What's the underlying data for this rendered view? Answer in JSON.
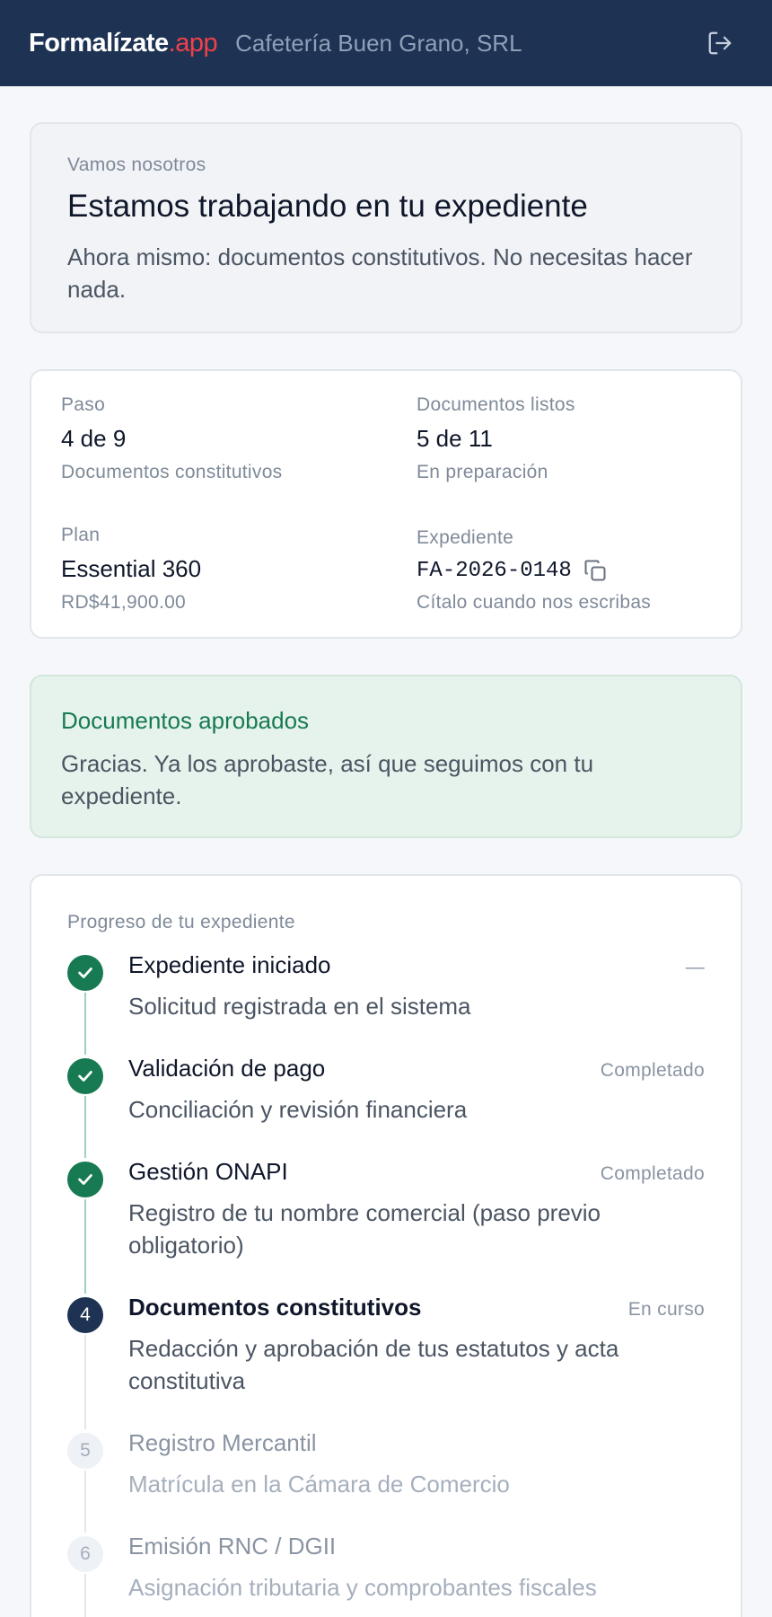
{
  "header": {
    "brand_main": "Formalízate",
    "brand_suffix": ".app",
    "company": "Cafetería Buen Grano, SRL",
    "logout_icon": "logout-icon"
  },
  "hero": {
    "eyebrow": "Vamos nosotros",
    "title": "Estamos trabajando en tu expediente",
    "description": "Ahora mismo: documentos constitutivos. No necesitas hacer nada."
  },
  "summary": {
    "step": {
      "label": "Paso",
      "value": "4 de 9",
      "sub": "Documentos constitutivos"
    },
    "docs": {
      "label": "Documentos listos",
      "value": "5 de 11",
      "sub": "En preparación"
    },
    "plan": {
      "label": "Plan",
      "value": "Essential 360",
      "sub": "RD$41,900.00"
    },
    "file": {
      "label": "Expediente",
      "value": "FA-2026-0148",
      "sub": "Cítalo cuando nos escribas",
      "copy_icon": "copy-icon"
    }
  },
  "approved": {
    "title": "Documentos aprobados",
    "text": "Gracias. Ya los aprobaste, así que seguimos con tu expediente."
  },
  "progress": {
    "title": "Progreso de tu expediente",
    "steps": [
      {
        "name": "Expediente iniciado",
        "status": "—",
        "desc": "Solicitud registrada en el sistema",
        "state": "done"
      },
      {
        "name": "Validación de pago",
        "status": "Completado",
        "desc": "Conciliación y revisión financiera",
        "state": "done"
      },
      {
        "name": "Gestión ONAPI",
        "status": "Completado",
        "desc": "Registro de tu nombre comercial (paso previo obligatorio)",
        "state": "done"
      },
      {
        "number": "4",
        "name": "Documentos constitutivos",
        "status": "En curso",
        "desc": "Redacción y aprobación de tus estatutos y acta constitutiva",
        "state": "current"
      },
      {
        "number": "5",
        "name": "Registro Mercantil",
        "status": "",
        "desc": "Matrícula en la Cámara de Comercio",
        "state": "pending"
      },
      {
        "number": "6",
        "name": "Emisión RNC / DGII",
        "status": "",
        "desc": "Asignación tributaria y comprobantes fiscales",
        "state": "pending"
      }
    ]
  },
  "colors": {
    "header_bg": "#1e3354",
    "brand_accent": "#f0404a",
    "success": "#177a52",
    "success_bg": "#e6f3ec"
  }
}
